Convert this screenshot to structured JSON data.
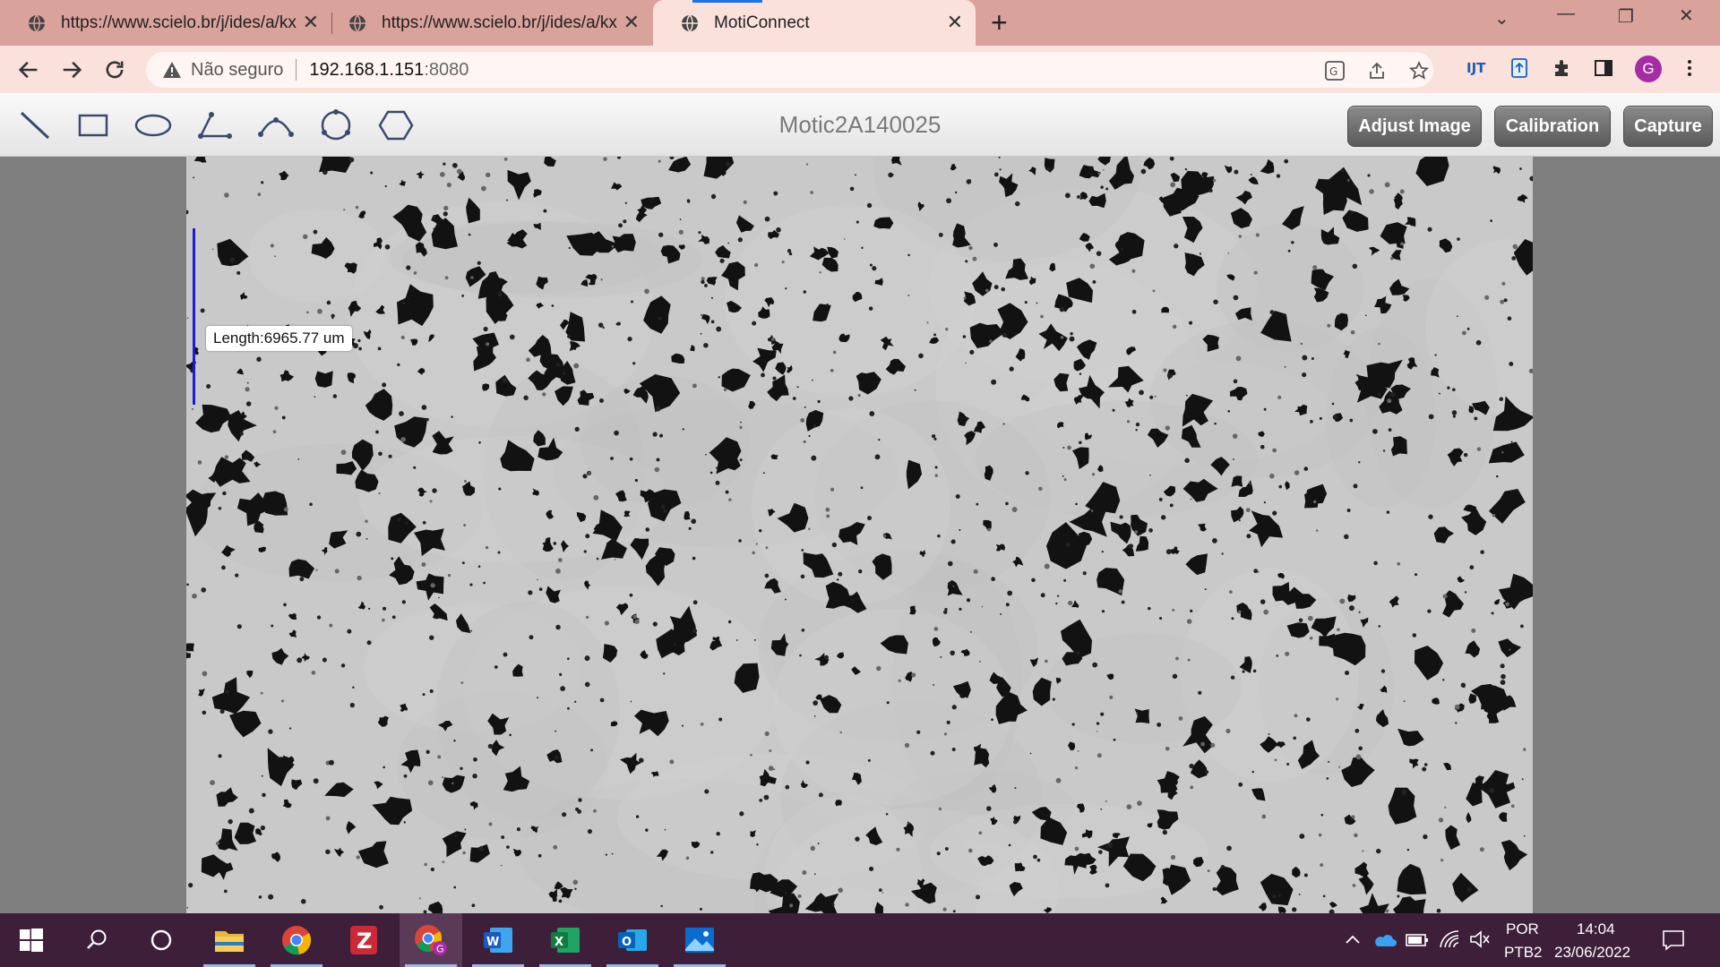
{
  "browser": {
    "tabs": [
      {
        "title": "https://www.scielo.br/j/ides/a/kx",
        "icon": "globe-icon",
        "active": false
      },
      {
        "title": "https://www.scielo.br/j/ides/a/kx",
        "icon": "globe-icon",
        "active": false
      },
      {
        "title": "MotiConnect",
        "icon": "globe-icon",
        "active": true
      }
    ],
    "address": {
      "security_text": "Não seguro",
      "host": "192.168.1.151",
      "port": ":8080"
    },
    "profile_initial": "G",
    "colors": {
      "frame": "#d9a39b",
      "toolbar": "#fbe1dc",
      "profile": "#a52ca5"
    }
  },
  "app": {
    "device_name": "Motic2A140025",
    "tools": [
      "line-tool-icon",
      "rectangle-tool-icon",
      "ellipse-tool-icon",
      "angle-tool-icon",
      "arc-tool-icon",
      "circle-tool-icon",
      "polygon-tool-icon"
    ],
    "buttons": {
      "adjust_image": "Adjust Image",
      "calibration": "Calibration",
      "capture": "Capture"
    },
    "measurement_label": "Length:6965.77 um"
  },
  "taskbar": {
    "apps": [
      "windows-start-icon",
      "search-icon",
      "cortana-icon",
      "file-explorer-icon",
      "chrome-icon",
      "zotero-icon",
      "chrome-profile-icon",
      "word-icon",
      "excel-icon",
      "outlook-icon",
      "photos-icon"
    ],
    "language": "POR",
    "keyboard": "PTB2",
    "time": "14:04",
    "date": "23/06/2022"
  }
}
